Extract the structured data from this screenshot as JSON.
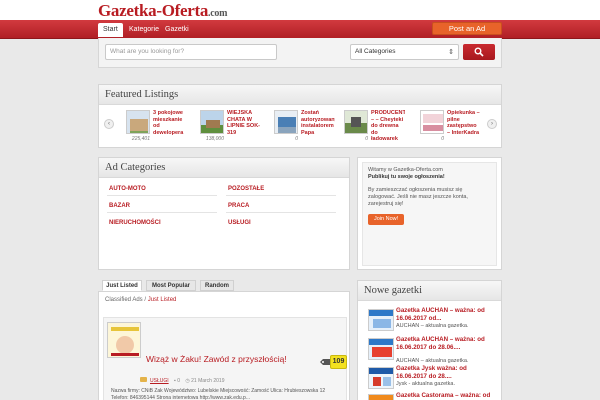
{
  "header": {
    "logo_main": "Gazetka-Oferta",
    "logo_domain": ".com",
    "nav": [
      {
        "label": "Start",
        "active": true
      },
      {
        "label": "Kategorie",
        "active": false
      },
      {
        "label": "Gazetki",
        "active": false
      }
    ],
    "post_ad_label": "Post an Ad"
  },
  "search": {
    "placeholder": "What are you looking for?",
    "category_value": "All Categories",
    "button_icon": "search-icon"
  },
  "featured": {
    "title": "Featured Listings",
    "items": [
      {
        "title": "3 pokojowe mieszkanie od dewelopera",
        "count": "225,401"
      },
      {
        "title": "WIEJSKA CHATA W LIPNIE SOK- 319",
        "count": "138,000"
      },
      {
        "title": "Zostań autoryzowanym instalatorem Papa",
        "count": "0"
      },
      {
        "title": "PRODUCENT – – Cheyteki do drewna do ładowarek",
        "count": "0"
      },
      {
        "title": "Opiekunka – pilne zastępstwo – InterKadra",
        "count": "0"
      }
    ]
  },
  "ad_categories": {
    "title": "Ad Categories",
    "items": [
      "AUTO-MOTO",
      "POZOSTAŁE",
      "BAZAR",
      "PRACA",
      "NIERUCHOMOŚCI",
      "USŁUGI"
    ]
  },
  "welcome": {
    "greeting": "Witamy w Gazetka-Oferta.com",
    "headline": "Publikuj tu swoje ogłoszenia!",
    "body": "By zamieszczać ogłoszenia musisz się zalogować. Jeśli nie masz jeszcze konta, zarejestruj się!",
    "join_label": "Join Now!"
  },
  "listing_tabs": [
    "Just Listed",
    "Most Popular",
    "Random"
  ],
  "breadcrumb": {
    "root": "Classified Ads",
    "separator": " / ",
    "current": "Just Listed"
  },
  "listing": {
    "title": "Wiząż w Żaku! Zawód z przyszłością!",
    "views": "109",
    "category": "USŁUGI",
    "comments": "0",
    "date": "21 March 2019",
    "description": "Nazwa firmy: CNiB Żak Województwo: Lubelskie Miejscowość: Zamość Ulica: Hrubieszowska 12 Telefon: 846395144 Strona internetowa http://www.zak.edu.p..."
  },
  "new_gazetki": {
    "title": "Nowe gazetki",
    "items": [
      {
        "title": "Gazetka AUCHAN – ważna: od 16.06.2017 od...",
        "sub": "AUCHAN – aktualna gazetka."
      },
      {
        "title": "Gazetka AUCHAN – ważna: od 16.06.2017 do 28.06....",
        "sub": "AUCHAN – aktualna gazetka."
      },
      {
        "title": "Gazetka Jysk ważna: od 16.06.2017 do 28....",
        "sub": "Jysk - aktualna gazetka."
      },
      {
        "title": "Gazetka Castorama – ważna: od",
        "sub": ""
      }
    ]
  },
  "colors": {
    "brand_red": "#b81c22",
    "accent_orange": "#e8632a",
    "badge_yellow": "#f3e11f"
  }
}
